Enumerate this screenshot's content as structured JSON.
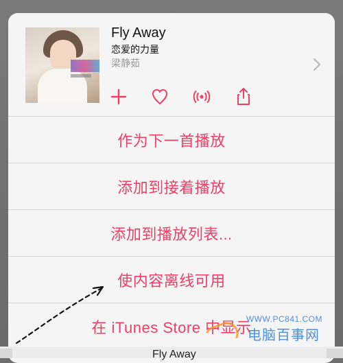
{
  "song": {
    "title": "Fly Away",
    "album": "恋爱的力量",
    "artist": "梁静茹"
  },
  "icons": [
    "plus-icon",
    "heart-icon",
    "radio-icon",
    "share-icon",
    "chevron-right-icon"
  ],
  "menu": {
    "items": [
      {
        "label": "作为下一首播放"
      },
      {
        "label": "添加到接着播放"
      },
      {
        "label": "添加到播放列表..."
      },
      {
        "label": "使内容离线可用"
      },
      {
        "label": "在 iTunes Store 中显示"
      }
    ]
  },
  "watermark": {
    "url": "WWW.PC841.COM",
    "name": "电脑百事网"
  },
  "bottom_bar": {
    "song_title": "Fly Away"
  },
  "colors": {
    "accent": "#ef3f67",
    "sheet_bg": "#f5f5f5",
    "separator": "#d9d9d9",
    "watermark": "#4f8fdc"
  }
}
